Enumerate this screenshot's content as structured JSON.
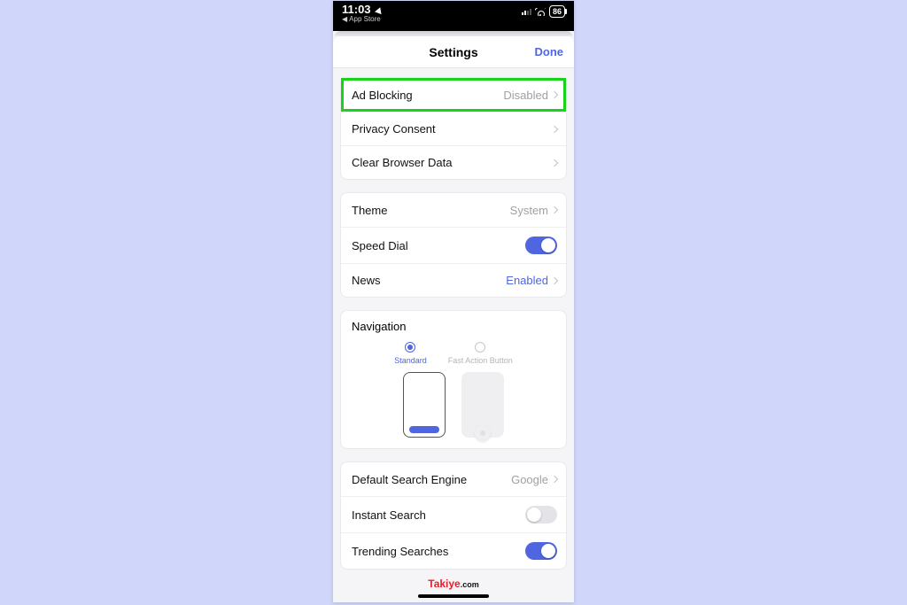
{
  "status": {
    "time": "11:03",
    "back_app": "App Store",
    "battery": "86"
  },
  "header": {
    "title": "Settings",
    "done": "Done"
  },
  "group1": {
    "ad_blocking": {
      "label": "Ad Blocking",
      "value": "Disabled"
    },
    "privacy": {
      "label": "Privacy Consent"
    },
    "clear_data": {
      "label": "Clear Browser Data"
    }
  },
  "group2": {
    "theme": {
      "label": "Theme",
      "value": "System"
    },
    "speed_dial": {
      "label": "Speed Dial",
      "on": true
    },
    "news": {
      "label": "News",
      "value": "Enabled"
    }
  },
  "navigation": {
    "title": "Navigation",
    "standard": "Standard",
    "fab": "Fast Action Button"
  },
  "group3": {
    "search_engine": {
      "label": "Default Search Engine",
      "value": "Google"
    },
    "instant_search": {
      "label": "Instant Search",
      "on": false
    },
    "trending": {
      "label": "Trending Searches",
      "on": true
    }
  },
  "watermark": {
    "brand": "Takiye",
    "suffix": ".com"
  }
}
